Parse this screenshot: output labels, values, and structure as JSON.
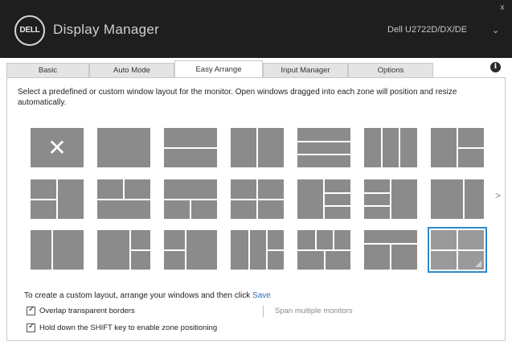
{
  "app": {
    "logo_text": "DELL",
    "title": "Display Manager",
    "monitor": "Dell U2722D/DX/DE",
    "close_glyph": "x",
    "chevron_glyph": "⌄",
    "info_glyph": "i"
  },
  "tabs": [
    {
      "label": "Basic",
      "active": false
    },
    {
      "label": "Auto Mode",
      "active": false
    },
    {
      "label": "Easy Arrange",
      "active": true
    },
    {
      "label": "Input Manager",
      "active": false
    },
    {
      "label": "Options",
      "active": false
    }
  ],
  "description": "Select a predefined or custom window layout for the monitor. Open windows dragged into each zone will position and resize automatically.",
  "layouts": {
    "count": 21,
    "selected_index": 20,
    "first_is_none": true,
    "none_glyph": "✕",
    "next_glyph": ">"
  },
  "hint": {
    "text": "To create a custom layout, arrange your windows and then click",
    "link": "Save"
  },
  "options": {
    "overlap": {
      "label": "Overlap transparent borders",
      "checked": true
    },
    "span": {
      "label": "Span multiple monitors",
      "checked": false
    },
    "shift": {
      "label": "Hold down the SHIFT key to enable zone positioning",
      "checked": true
    }
  },
  "colors": {
    "titlebar": "#1e1e1e",
    "tile": "#8b8b8b",
    "selection": "#2f89c8",
    "link": "#2f6fb0"
  }
}
